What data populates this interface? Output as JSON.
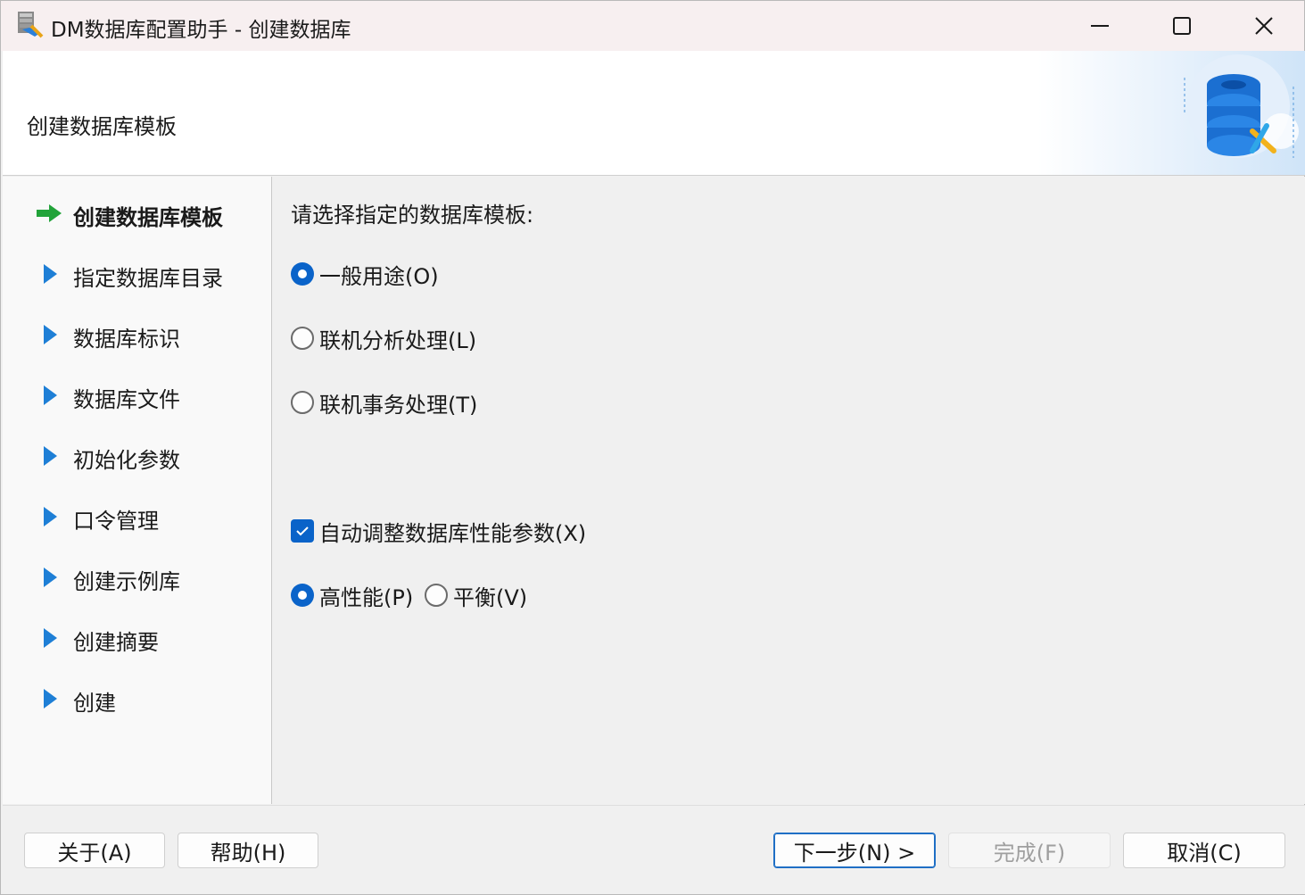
{
  "window": {
    "title": "DM数据库配置助手 - 创建数据库",
    "controls": {
      "minimize": "minimize-icon",
      "maximize": "maximize-icon",
      "close": "close-icon"
    }
  },
  "header": {
    "title": "创建数据库模板",
    "illustration": "database-wrench-illustration"
  },
  "steps": [
    {
      "label": "创建数据库模板",
      "active": true
    },
    {
      "label": "指定数据库目录",
      "active": false
    },
    {
      "label": "数据库标识",
      "active": false
    },
    {
      "label": "数据库文件",
      "active": false
    },
    {
      "label": "初始化参数",
      "active": false
    },
    {
      "label": "口令管理",
      "active": false
    },
    {
      "label": "创建示例库",
      "active": false
    },
    {
      "label": "创建摘要",
      "active": false
    },
    {
      "label": "创建",
      "active": false
    }
  ],
  "main": {
    "prompt": "请选择指定的数据库模板:",
    "template_options": [
      {
        "label": "一般用途(O)",
        "checked": true
      },
      {
        "label": "联机分析处理(L)",
        "checked": false
      },
      {
        "label": "联机事务处理(T)",
        "checked": false
      }
    ],
    "auto_tune": {
      "label": "自动调整数据库性能参数(X)",
      "checked": true
    },
    "mode_options": [
      {
        "label": "高性能(P)",
        "checked": true
      },
      {
        "label": "平衡(V)",
        "checked": false
      }
    ]
  },
  "footer": {
    "about": "关于(A)",
    "help": "帮助(H)",
    "next": "下一步(N) >",
    "finish": "完成(F)",
    "cancel": "取消(C)"
  },
  "colors": {
    "accent": "#0a63c9",
    "active_arrow": "#22a33a",
    "step_arrow": "#1e7fd6",
    "titlebar": "#f7eff0"
  }
}
